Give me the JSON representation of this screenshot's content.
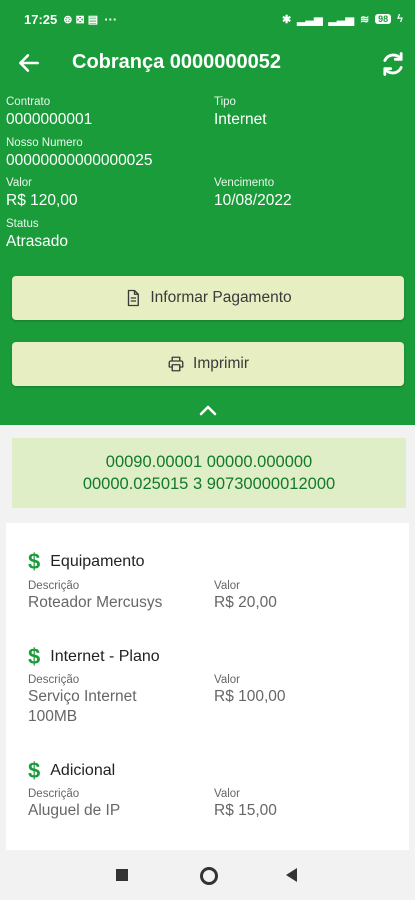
{
  "status_bar": {
    "time": "17:25",
    "left_icons": "⊛ ⊠ ▤",
    "more": "···",
    "battery": "98"
  },
  "app_bar": {
    "title": "Cobrança 0000000052"
  },
  "details": {
    "contrato_label": "Contrato",
    "contrato_value": "0000000001",
    "tipo_label": "Tipo",
    "tipo_value": "Internet",
    "nosso_label": "Nosso Numero",
    "nosso_value": "00000000000000025",
    "valor_label": "Valor",
    "valor_value": "R$ 120,00",
    "vencimento_label": "Vencimento",
    "vencimento_value": "10/08/2022",
    "status_label": "Status",
    "status_value": "Atrasado"
  },
  "buttons": {
    "informar": "Informar Pagamento",
    "imprimir": "Imprimir"
  },
  "barcode": {
    "line1": "00090.00001 00000.000000",
    "line2": "00000.025015 3 90730000012000"
  },
  "items": [
    {
      "title": "Equipamento",
      "desc_label": "Descrição",
      "desc": "Roteador Mercusys",
      "valor_label": "Valor",
      "valor": "R$ 20,00"
    },
    {
      "title": "Internet - Plano",
      "desc_label": "Descrição",
      "desc": "Serviço Internet 100MB",
      "valor_label": "Valor",
      "valor": "R$ 100,00"
    },
    {
      "title": "Adicional",
      "desc_label": "Descrição",
      "desc": "Aluguel de IP",
      "valor_label": "Valor",
      "valor": "R$ 15,00"
    }
  ],
  "colors": {
    "primary": "#1a9c3a",
    "button_bg": "#e7eec2",
    "barcode_bg": "#e0eec7",
    "barcode_text": "#117a2a"
  },
  "icons": [
    "back-arrow-icon",
    "refresh-icon",
    "document-icon",
    "printer-icon",
    "chevron-up-icon",
    "dollar-icon"
  ]
}
